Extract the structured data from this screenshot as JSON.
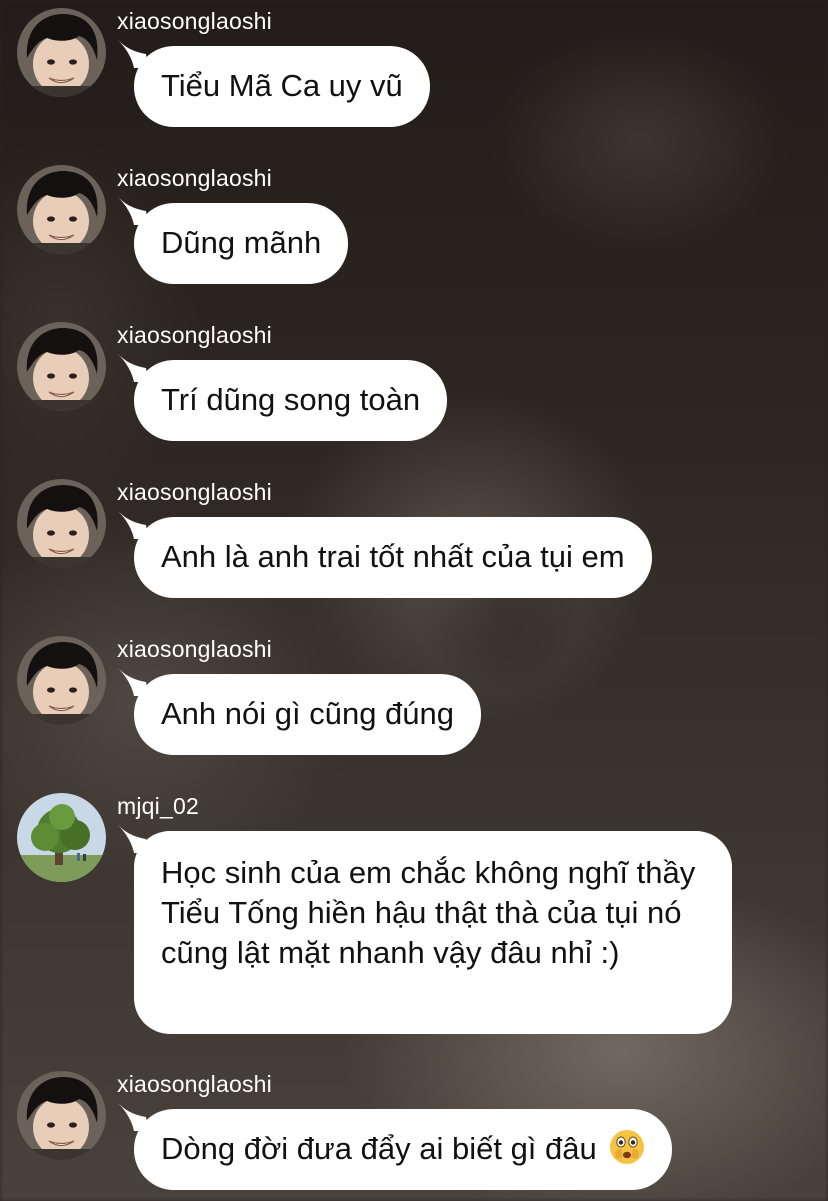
{
  "messages": [
    {
      "username": "xiaosonglaoshi",
      "text": "Tiểu Mã Ca uy vũ",
      "avatar": "boy-avatar-icon"
    },
    {
      "username": "xiaosonglaoshi",
      "text": "Dũng mãnh",
      "avatar": "boy-avatar-icon"
    },
    {
      "username": "xiaosonglaoshi",
      "text": "Trí dũng song toàn",
      "avatar": "boy-avatar-icon"
    },
    {
      "username": "xiaosonglaoshi",
      "text": "Anh là anh trai tốt nhất của tụi em",
      "avatar": "boy-avatar-icon"
    },
    {
      "username": "xiaosonglaoshi",
      "text": "Anh nói gì cũng đúng",
      "avatar": "boy-avatar-icon"
    },
    {
      "username": "mjqi_02",
      "text": "Học sinh của em chắc không nghĩ thầy Tiểu Tống hiền hậu thật thà của tụi nó cũng lật mặt nhanh vậy đâu nhỉ :)",
      "avatar": "tree-avatar-icon"
    },
    {
      "username": "xiaosonglaoshi",
      "text": "Dòng đời đưa đẩy ai biết gì đâu",
      "avatar": "boy-avatar-icon",
      "emoji": "face-with-open-eyes-and-hand-over-mouth-icon"
    }
  ],
  "colors": {
    "bubble": "#ffffff",
    "text": "#111111",
    "username": "#ffffff",
    "background": "#2a2421"
  }
}
